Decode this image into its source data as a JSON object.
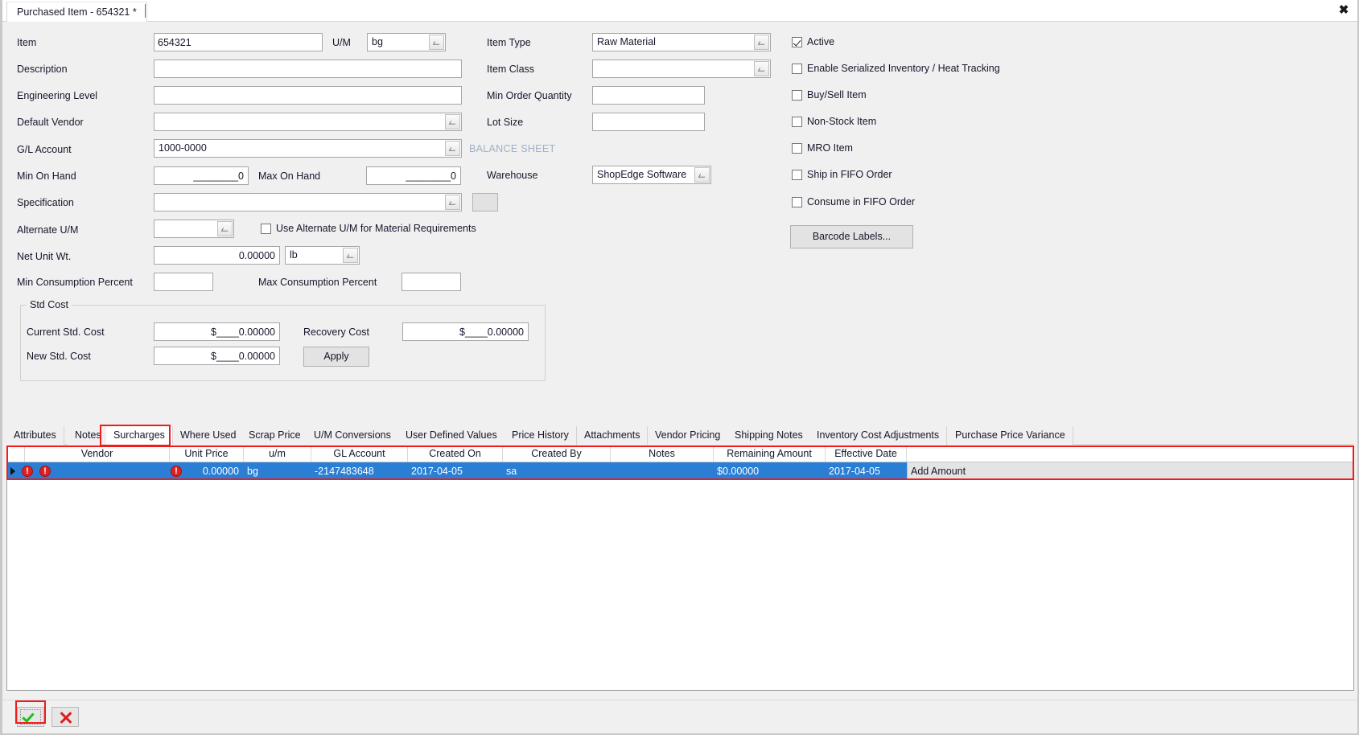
{
  "window": {
    "doc_tab_title": "Purchased Item - 654321 *",
    "close_label": "✖"
  },
  "form": {
    "left_fields": [
      {
        "label": "Item",
        "value": "654321"
      },
      {
        "label": "Description",
        "value": ""
      },
      {
        "label": "Engineering Level",
        "value": ""
      },
      {
        "label": "Default Vendor",
        "value": ""
      },
      {
        "label": "G/L Account",
        "value": "1000-0000"
      },
      {
        "label": "Min On Hand",
        "value": "________0"
      },
      {
        "label": "Max On Hand",
        "value": "________0"
      },
      {
        "label": "Specification",
        "value": ""
      },
      {
        "label": "Alternate U/M",
        "value": ""
      },
      {
        "label": "Net Unit Wt.",
        "value": "0.00000"
      },
      {
        "label": "Min Consumption Percent",
        "value": ""
      },
      {
        "label": "Max Consumption Percent",
        "value": ""
      }
    ],
    "um_label": "U/M",
    "um_value": "bg",
    "net_unit_wt_um": "lb",
    "balance_sheet_label": "BALANCE SHEET",
    "use_alt_um_label": "Use Alternate U/M for Material Requirements",
    "use_alt_um_checked": false,
    "middle_fields": [
      {
        "label": "Item Type",
        "value": "Raw Material"
      },
      {
        "label": "Item Class",
        "value": ""
      },
      {
        "label": "Min Order Quantity",
        "value": ""
      },
      {
        "label": "Lot Size",
        "value": ""
      },
      {
        "label": "Warehouse",
        "value": "ShopEdge Software"
      }
    ],
    "checkboxes": [
      {
        "label": "Active",
        "checked": true
      },
      {
        "label": "Enable Serialized Inventory / Heat Tracking",
        "checked": false
      },
      {
        "label": "Buy/Sell Item",
        "checked": false
      },
      {
        "label": "Non-Stock Item",
        "checked": false
      },
      {
        "label": "MRO Item",
        "checked": false
      },
      {
        "label": "Ship in FIFO Order",
        "checked": false
      },
      {
        "label": "Consume in FIFO Order",
        "checked": false
      }
    ],
    "barcode_button": "Barcode Labels...",
    "std_cost": {
      "group_title": "Std Cost",
      "current_label": "Current Std. Cost",
      "current_value": "$____0.00000",
      "recovery_label": "Recovery Cost",
      "recovery_value": "$____0.00000",
      "new_label": "New Std. Cost",
      "new_value": "$____0.00000",
      "apply_button": "Apply"
    }
  },
  "tabs": {
    "active": "Surcharges",
    "items": [
      "Attributes",
      "Notes",
      "Surcharges",
      "Where Used",
      "Scrap Price",
      "U/M Conversions",
      "User Defined Values",
      "Price History",
      "Attachments",
      "Vendor Pricing",
      "Shipping Notes",
      "Inventory Cost Adjustments",
      "Purchase Price Variance"
    ]
  },
  "grid": {
    "columns": [
      "Vendor",
      "Unit Price",
      "u/m",
      "GL Account",
      "Created On",
      "Created By",
      "Notes",
      "Remaining Amount",
      "Effective Date",
      ""
    ],
    "rows": [
      {
        "Vendor": "",
        "Unit Price": "0.00000",
        "u/m": "bg",
        "GL Account": "-2147483648",
        "Created On": "2017-04-05",
        "Created By": "sa",
        "Notes": "",
        "Remaining Amount": "$0.00000",
        "Effective Date": "2017-04-05",
        "Action": "Add Amount"
      }
    ]
  },
  "toolbar": {
    "accept_label": "accept",
    "cancel_label": "cancel"
  },
  "colors": {
    "selection": "#2a7fd4",
    "highlight": "#f01c1c",
    "error": "#e02020",
    "form_bg": "#f0f0f0",
    "dim_text": "#a0b0c8"
  }
}
